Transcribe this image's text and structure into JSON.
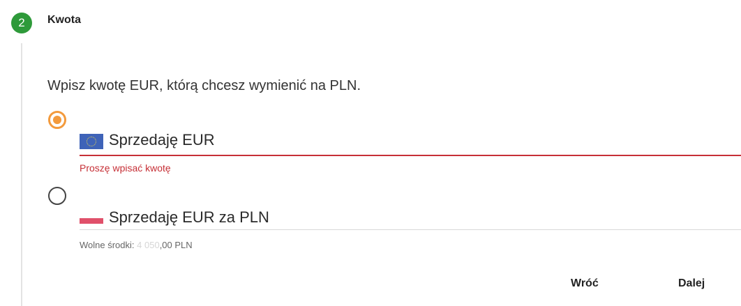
{
  "step": {
    "number": "2",
    "title": "Kwota"
  },
  "instruction": "Wpisz kwotę EUR, którą chcesz wymienić na PLN.",
  "options": [
    {
      "label": "Sprzedaję EUR",
      "selected": true,
      "flag": "eu-flag-icon"
    },
    {
      "label": "Sprzedaję EUR za PLN",
      "selected": false,
      "flag": "pl-flag-icon"
    }
  ],
  "error_message": "Proszę wpisać kwotę",
  "balance": {
    "label": "Wolne środki:",
    "amount_masked": "4 050",
    "amount_suffix": ",00 PLN"
  },
  "buttons": {
    "back": "Wróć",
    "next": "Dalej"
  },
  "colors": {
    "accent": "#f39a3c",
    "error": "#c62f36",
    "step": "#2e9a3a"
  }
}
